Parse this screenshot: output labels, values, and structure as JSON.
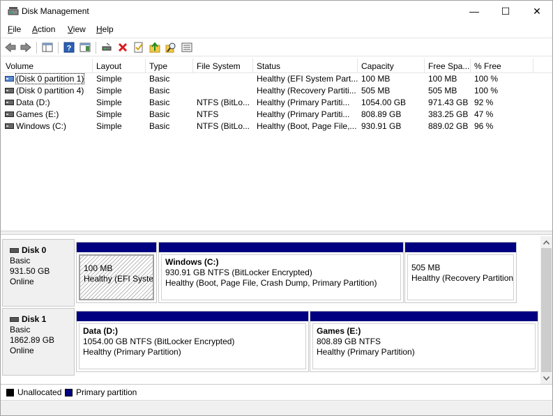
{
  "window": {
    "title": "Disk Management",
    "controls": {
      "minimize": "—",
      "maximize": "☐",
      "close": "✕"
    }
  },
  "menu": [
    {
      "label": "File",
      "accel": "F",
      "rest": "ile"
    },
    {
      "label": "Action",
      "accel": "A",
      "rest": "ction"
    },
    {
      "label": "View",
      "accel": "V",
      "rest": "iew"
    },
    {
      "label": "Help",
      "accel": "H",
      "rest": "elp"
    }
  ],
  "toolbar": {
    "buttons": [
      "back-icon",
      "forward-icon",
      "console-tree-icon",
      "help-icon",
      "action-pane-icon",
      "connect-drive-icon",
      "delete-icon",
      "properties-icon",
      "up-folder-icon",
      "search-icon",
      "list-icon"
    ]
  },
  "volume_list": {
    "columns": [
      "Volume",
      "Layout",
      "Type",
      "File System",
      "Status",
      "Capacity",
      "Free Spa...",
      "% Free"
    ],
    "rows": [
      {
        "volume": "(Disk 0 partition 1)",
        "layout": "Simple",
        "type": "Basic",
        "fs": "",
        "status": "Healthy (EFI System Part...",
        "capacity": "100 MB",
        "free": "100 MB",
        "pct": "100 %"
      },
      {
        "volume": "(Disk 0 partition 4)",
        "layout": "Simple",
        "type": "Basic",
        "fs": "",
        "status": "Healthy (Recovery Partiti...",
        "capacity": "505 MB",
        "free": "505 MB",
        "pct": "100 %"
      },
      {
        "volume": "Data (D:)",
        "layout": "Simple",
        "type": "Basic",
        "fs": "NTFS (BitLo...",
        "status": "Healthy (Primary Partiti...",
        "capacity": "1054.00 GB",
        "free": "971.43 GB",
        "pct": "92 %"
      },
      {
        "volume": "Games (E:)",
        "layout": "Simple",
        "type": "Basic",
        "fs": "NTFS",
        "status": "Healthy (Primary Partiti...",
        "capacity": "808.89 GB",
        "free": "383.25 GB",
        "pct": "47 %"
      },
      {
        "volume": "Windows (C:)",
        "layout": "Simple",
        "type": "Basic",
        "fs": "NTFS (BitLo...",
        "status": "Healthy (Boot, Page File,...",
        "capacity": "930.91 GB",
        "free": "889.02 GB",
        "pct": "96 %"
      }
    ]
  },
  "disks": [
    {
      "name": "Disk 0",
      "type": "Basic",
      "size": "931.50 GB",
      "state": "Online",
      "partitions": [
        {
          "title": "",
          "size": "100 MB",
          "status": "Healthy (EFI System"
        },
        {
          "title": "Windows  (C:)",
          "size": "930.91 GB NTFS (BitLocker Encrypted)",
          "status": "Healthy (Boot, Page File, Crash Dump, Primary Partition)"
        },
        {
          "title": "",
          "size": "505 MB",
          "status": "Healthy (Recovery Partition"
        }
      ]
    },
    {
      "name": "Disk 1",
      "type": "Basic",
      "size": "1862.89 GB",
      "state": "Online",
      "partitions": [
        {
          "title": "Data  (D:)",
          "size": "1054.00 GB NTFS (BitLocker Encrypted)",
          "status": "Healthy (Primary Partition)"
        },
        {
          "title": "Games  (E:)",
          "size": "808.89 GB NTFS",
          "status": "Healthy (Primary Partition)"
        }
      ]
    }
  ],
  "legend": [
    {
      "label": "Unallocated",
      "color": "#000000"
    },
    {
      "label": "Primary partition",
      "color": "#000080"
    }
  ],
  "colors": {
    "partition_bar": "#000080",
    "unallocated": "#000000"
  }
}
